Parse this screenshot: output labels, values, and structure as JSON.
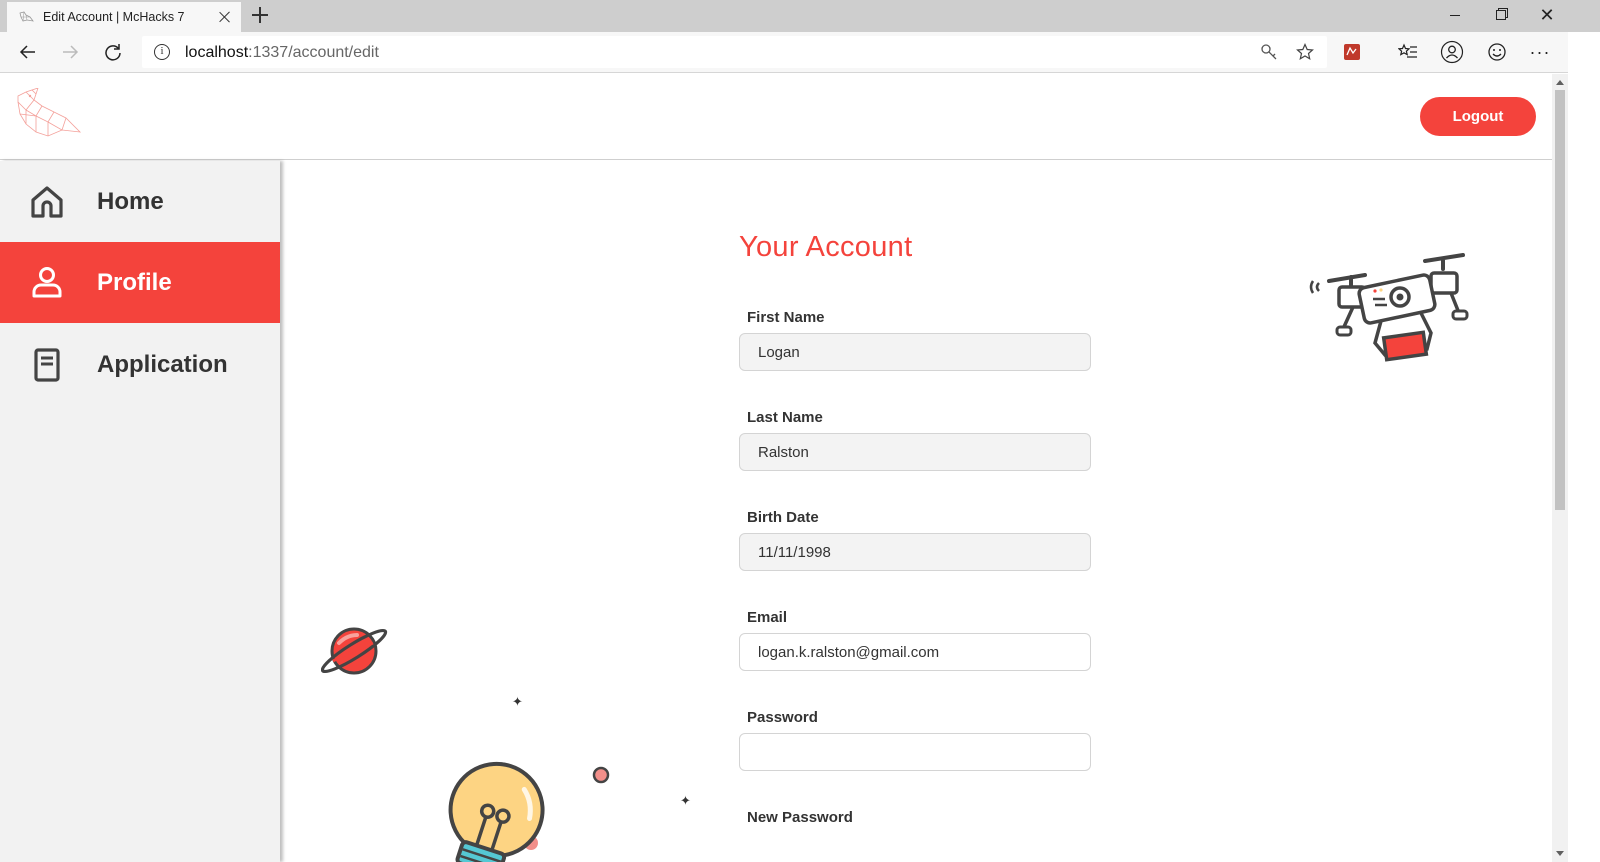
{
  "browser": {
    "tab_title": "Edit Account | McHacks 7",
    "url_host": "localhost",
    "url_path": ":1337/account/edit"
  },
  "header": {
    "logout_label": "Logout",
    "brand_color": "#f4433c"
  },
  "sidebar": {
    "items": [
      {
        "label": "Home",
        "icon": "home-icon",
        "active": false
      },
      {
        "label": "Profile",
        "icon": "user-icon",
        "active": true
      },
      {
        "label": "Application",
        "icon": "document-icon",
        "active": false
      }
    ]
  },
  "form": {
    "title": "Your Account",
    "fields": [
      {
        "label": "First Name",
        "value": "Logan"
      },
      {
        "label": "Last Name",
        "value": "Ralston"
      },
      {
        "label": "Birth Date",
        "value": "11/11/1998"
      },
      {
        "label": "Email",
        "value": "logan.k.ralston@gmail.com"
      },
      {
        "label": "Password",
        "value": ""
      },
      {
        "label": "New Password",
        "value": ""
      }
    ]
  }
}
